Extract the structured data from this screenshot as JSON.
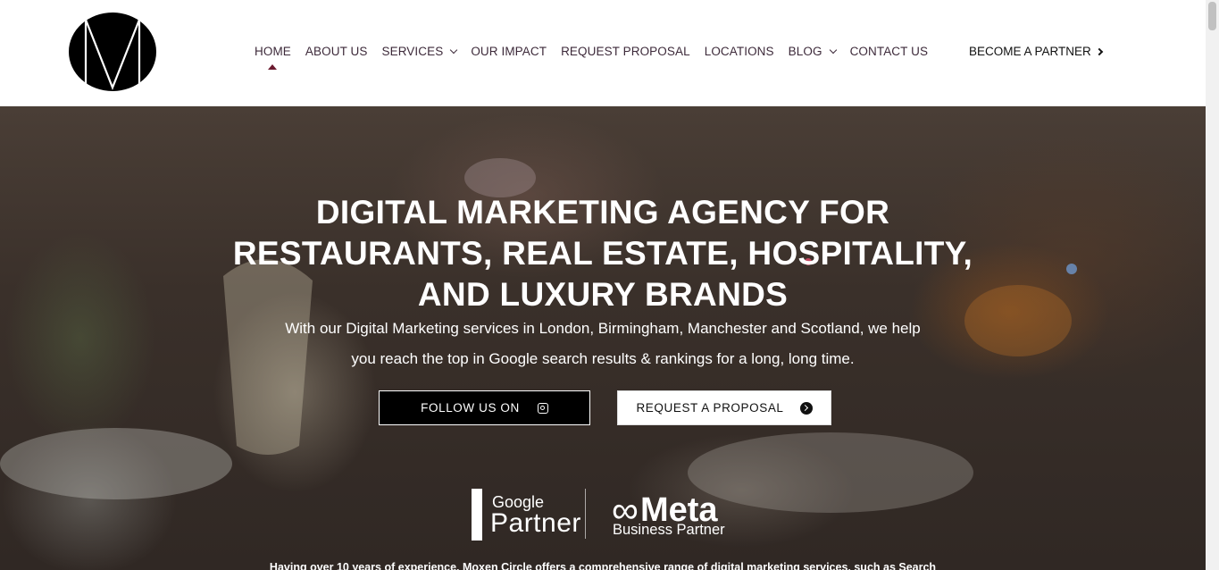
{
  "brand": {
    "logo_icon": "m-circle-logo"
  },
  "nav": {
    "items": [
      {
        "label": "HOME",
        "active": true,
        "dropdown": false
      },
      {
        "label": "ABOUT US",
        "active": false,
        "dropdown": false
      },
      {
        "label": "SERVICES",
        "active": false,
        "dropdown": true
      },
      {
        "label": "OUR IMPACT",
        "active": false,
        "dropdown": false
      },
      {
        "label": "REQUEST PROPOSAL",
        "active": false,
        "dropdown": false
      },
      {
        "label": "LOCATIONS",
        "active": false,
        "dropdown": false
      },
      {
        "label": "BLOG",
        "active": false,
        "dropdown": true
      },
      {
        "label": "CONTACT US",
        "active": false,
        "dropdown": false
      }
    ],
    "partner_label": "BECOME A PARTNER"
  },
  "hero": {
    "title_lines": [
      "DIGITAL MARKETING AGENCY FOR",
      "RESTAURANTS, REAL ESTATE, HOSPITALITY,",
      "AND LUXURY BRANDS"
    ],
    "subtitle_lines": [
      "With our Digital Marketing services in London, Birmingham, Manchester and Scotland, we help",
      "you reach the top in Google search results & rankings for a long, long time."
    ],
    "follow_button": "FOLLOW US ON",
    "follow_icon": "instagram-icon",
    "proposal_button": "REQUEST A PROPOSAL",
    "proposal_icon": "arrow-circle-right-icon",
    "google_badge": {
      "top": "Google",
      "bottom": "Partner"
    },
    "meta_badge": {
      "top": "Meta",
      "bottom": "Business Partner"
    },
    "intro_text": "Having over 10 years of experience, Moxen Circle offers a comprehensive range of digital marketing services, such as Search"
  },
  "colors": {
    "active_marker": "#6b1a2f",
    "nav_text": "#3d2a3a"
  }
}
